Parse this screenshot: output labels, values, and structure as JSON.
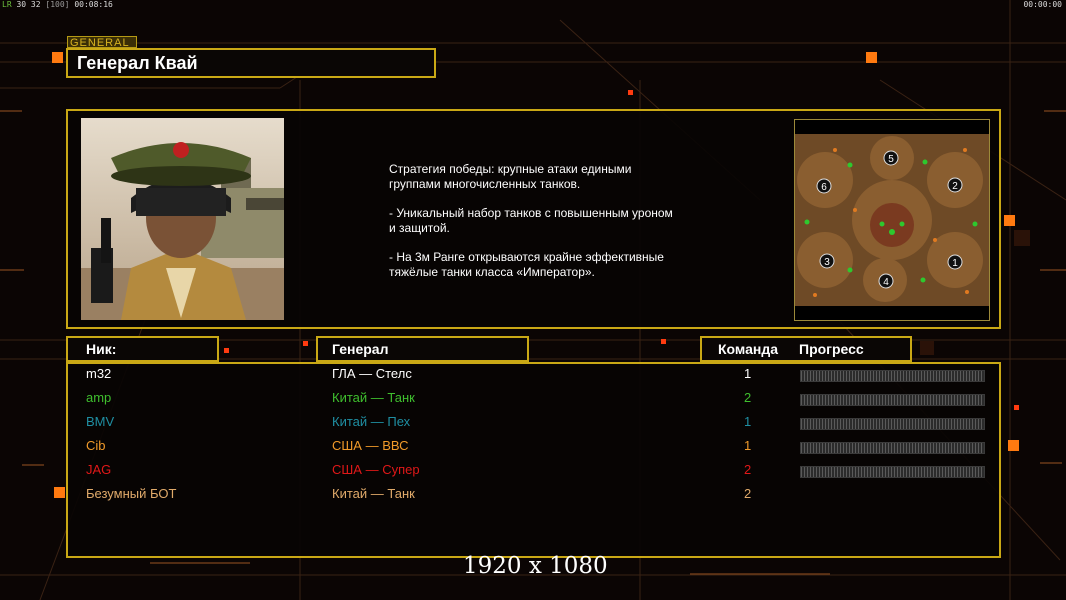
{
  "status_bar": {
    "fps": "LR",
    "left_values": "30 32",
    "bracket": "[100]",
    "time_left": "00:08:16",
    "time_right": "00:00:00"
  },
  "general_tag": "GENERAL",
  "general_name": "Генерал Квай",
  "description": [
    "Стратегия победы: крупные атаки едиными\n группами многочисленных танков.",
    "- Уникальный набор танков с повышенным уроном\n и защитой.",
    "- На 3м Ранге открываются крайне эффективные\n тяжёлые танки класса «Император»."
  ],
  "minimap": {
    "start_positions": [
      "5",
      "6",
      "2",
      "3",
      "4",
      "1"
    ]
  },
  "columns": {
    "nick": "Ник:",
    "general": "Генерал",
    "team": "Команда",
    "progress": "Прогресс"
  },
  "players": [
    {
      "nick": "m32",
      "general": "ГЛА — Стелс",
      "team": "1",
      "color": "#ffffff",
      "progress": 0
    },
    {
      "nick": "amp",
      "general": "Китай — Танк",
      "team": "2",
      "color": "#3fbf2e",
      "progress": 0
    },
    {
      "nick": "BMV",
      "general": "Китай — Пех",
      "team": "1",
      "color": "#1f8fa3",
      "progress": 0
    },
    {
      "nick": "Cib",
      "general": "США — ВВС",
      "team": "1",
      "color": "#f09a2a",
      "progress": 0
    },
    {
      "nick": "JAG",
      "general": "США — Супер",
      "team": "2",
      "color": "#e01818",
      "progress": 0
    },
    {
      "nick": "Безумный БОТ",
      "general": "Китай — Танк",
      "team": "2",
      "color": "#e0aa6a",
      "progress": null
    }
  ],
  "resolution_label": "1920 x 1080",
  "theme": {
    "frame": "#c9a815",
    "accent": "#ff7a10"
  }
}
